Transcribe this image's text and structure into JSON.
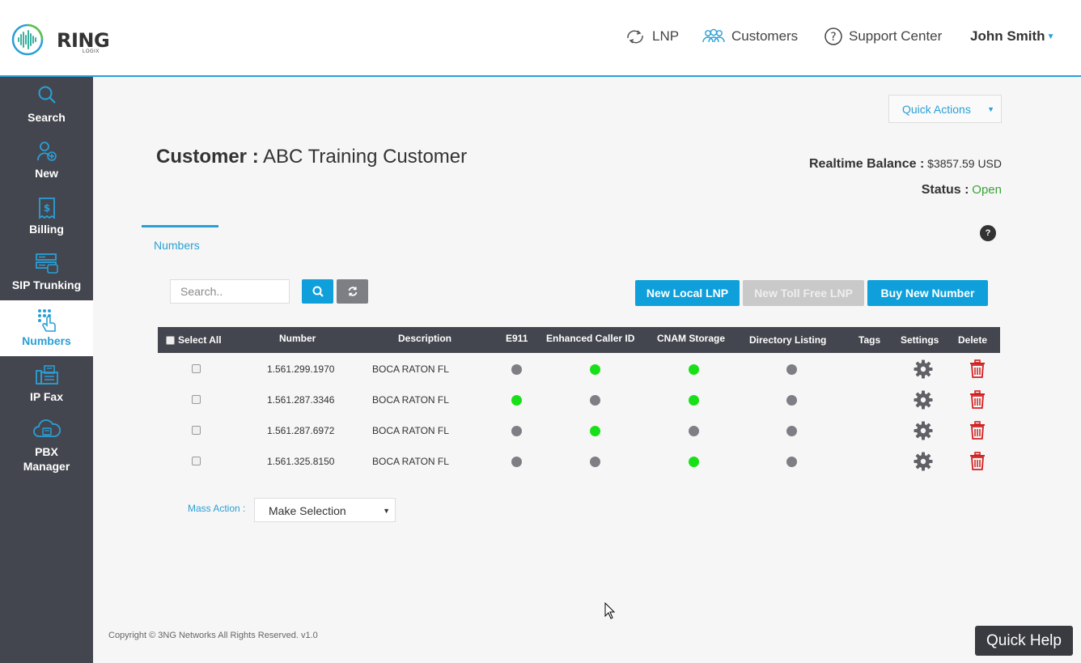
{
  "brand": {
    "name": "RING",
    "sub": "LOGIX"
  },
  "topnav": {
    "lnp": "LNP",
    "customers": "Customers",
    "support": "Support Center",
    "user": "John Smith"
  },
  "sidebar": {
    "items": [
      {
        "label": "Search",
        "icon": "search-icon"
      },
      {
        "label": "New",
        "icon": "add-user-icon"
      },
      {
        "label": "Billing",
        "icon": "billing-icon"
      },
      {
        "label": "SIP Trunking",
        "icon": "sip-trunking-icon"
      },
      {
        "label": "Numbers",
        "icon": "numbers-keypad-icon",
        "active": true
      },
      {
        "label": "IP Fax",
        "icon": "fax-icon"
      },
      {
        "label": "PBX Manager",
        "icon": "cloud-pbx-icon"
      }
    ]
  },
  "quick_actions": "Quick Actions",
  "customer": {
    "label": "Customer :",
    "name": "ABC Training Customer",
    "balance_label": "Realtime Balance :",
    "balance_value": "$3857.59 USD",
    "status_label": "Status :",
    "status_value": "Open"
  },
  "tab": "Numbers",
  "help": "?",
  "search": {
    "placeholder": "Search.."
  },
  "buttons": {
    "new_local_lnp": "New Local LNP",
    "new_toll_free_lnp": "New Toll Free LNP",
    "buy_new_number": "Buy New Number"
  },
  "table": {
    "headers": {
      "select_all": "Select All",
      "number": "Number",
      "description": "Description",
      "e911": "E911",
      "enhanced_caller_id": "Enhanced Caller ID",
      "cnam_storage": "CNAM Storage",
      "directory_listing": "Directory Listing",
      "tags": "Tags",
      "settings": "Settings",
      "delete": "Delete"
    },
    "rows": [
      {
        "number": "1.561.299.1970",
        "description": "BOCA RATON FL",
        "e911": false,
        "enhanced_caller_id": true,
        "cnam_storage": true,
        "directory_listing": false
      },
      {
        "number": "1.561.287.3346",
        "description": "BOCA RATON FL",
        "e911": true,
        "enhanced_caller_id": false,
        "cnam_storage": true,
        "directory_listing": false
      },
      {
        "number": "1.561.287.6972",
        "description": "BOCA RATON FL",
        "e911": false,
        "enhanced_caller_id": true,
        "cnam_storage": false,
        "directory_listing": false
      },
      {
        "number": "1.561.325.8150",
        "description": "BOCA RATON FL",
        "e911": false,
        "enhanced_caller_id": false,
        "cnam_storage": true,
        "directory_listing": false
      }
    ]
  },
  "mass_action": {
    "label": "Mass Action :",
    "selected": "Make Selection"
  },
  "footer": "Copyright © 3NG Networks All Rights Reserved. v1.0",
  "quick_help": "Quick Help",
  "colors": {
    "accent": "#2a9fd6",
    "sidebar": "#44464f",
    "status_on": "#18e018",
    "status_off": "#7d7f85",
    "delete": "#d21f1f",
    "open": "#3aa33a"
  }
}
